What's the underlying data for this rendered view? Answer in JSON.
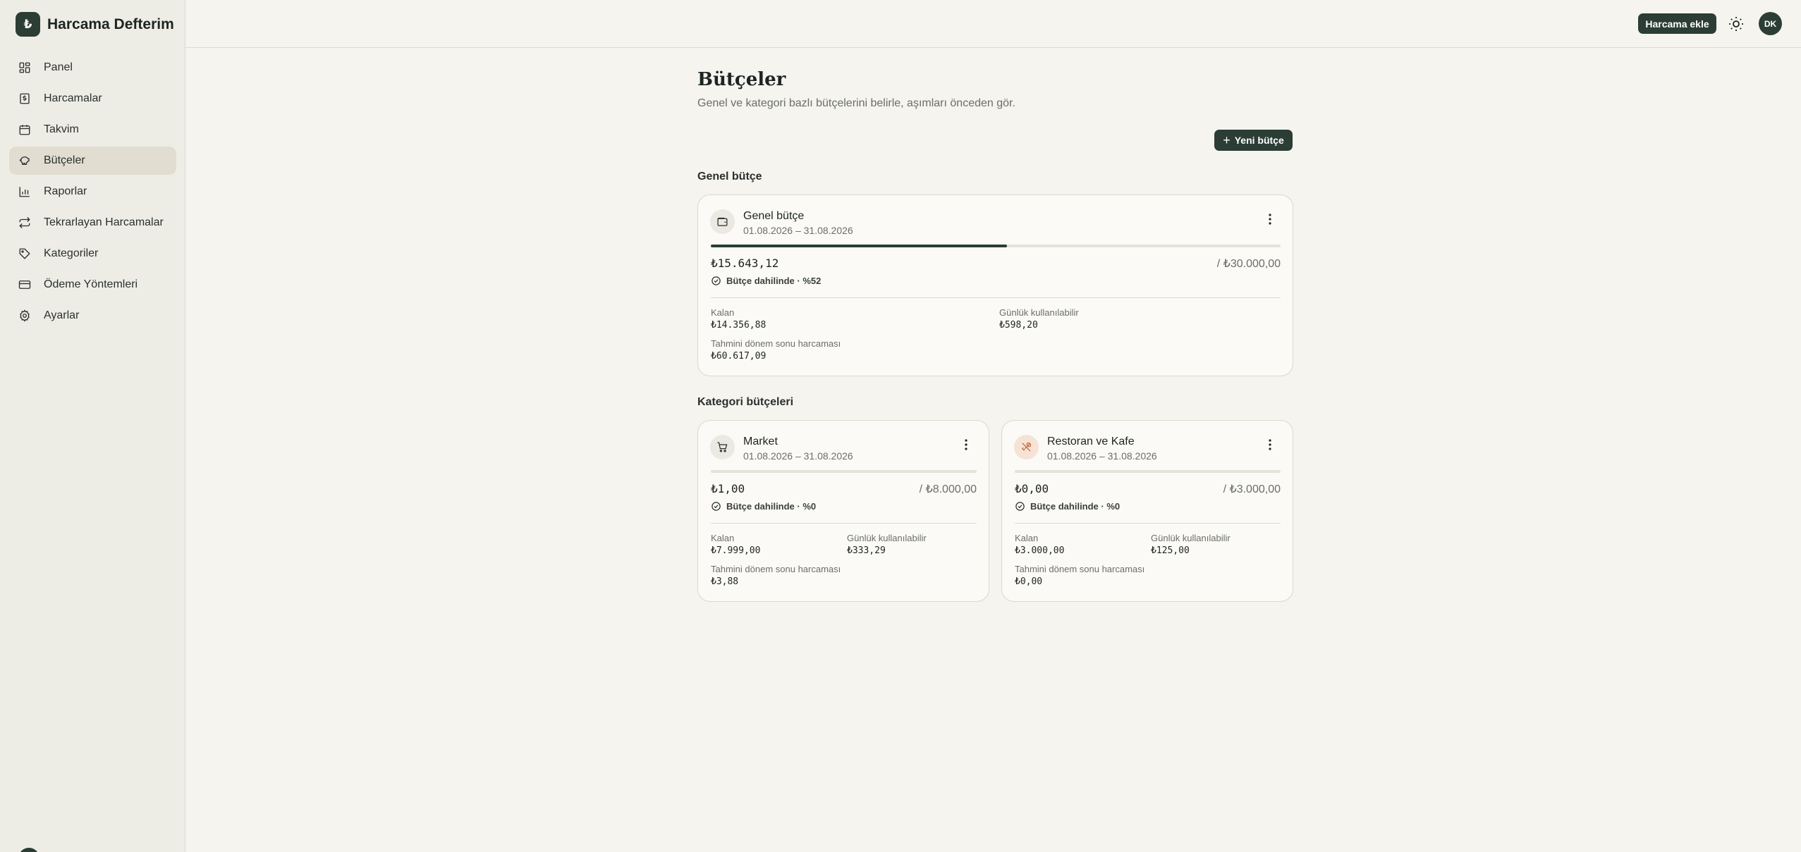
{
  "app": {
    "logo_glyph": "₺",
    "name": "Harcama Defterim"
  },
  "sidebar": {
    "items": [
      {
        "label": "Panel",
        "icon": "dashboard-icon"
      },
      {
        "label": "Harcamalar",
        "icon": "receipt-icon"
      },
      {
        "label": "Takvim",
        "icon": "calendar-icon"
      },
      {
        "label": "Bütçeler",
        "icon": "piggy-bank-icon",
        "active": true
      },
      {
        "label": "Raporlar",
        "icon": "bar-chart-icon"
      },
      {
        "label": "Tekrarlayan Harcamalar",
        "icon": "repeat-icon"
      },
      {
        "label": "Kategoriler",
        "icon": "tag-icon"
      },
      {
        "label": "Ödeme Yöntemleri",
        "icon": "credit-card-icon"
      },
      {
        "label": "Ayarlar",
        "icon": "gear-icon"
      }
    ]
  },
  "topbar": {
    "add_expense_label": "Harcama ekle",
    "theme_icon": "sun-icon",
    "avatar_initials": "DK"
  },
  "page": {
    "title": "Bütçeler",
    "subtitle": "Genel ve kategori bazlı bütçelerini belirle, aşımları önceden gör.",
    "new_budget_label": "Yeni bütçe",
    "general_section_title": "Genel bütçe",
    "category_section_title": "Kategori bütçeleri"
  },
  "colors": {
    "accent": "#2b3d35",
    "background": "#f5f4ef",
    "sidebar": "#eeede5",
    "card": "#fbfaf6"
  },
  "general_budget": {
    "name": "Genel bütçe",
    "icon": "wallet-icon",
    "date_range": "01.08.2026 – 31.08.2026",
    "spent": "₺15.643,12",
    "limit": "/ ₺30.000,00",
    "progress_fraction": 0.52,
    "status": "Bütçe dahilinde · %52",
    "remaining_label": "Kalan",
    "remaining_value": "₺14.356,88",
    "daily_label": "Günlük kullanılabilir",
    "daily_value": "₺598,20",
    "forecast_label": "Tahmini dönem sonu harcaması",
    "forecast_value": "₺60.617,09"
  },
  "category_budgets": [
    {
      "name": "Market",
      "icon": "shopping-cart-icon",
      "date_range": "01.08.2026 – 31.08.2026",
      "spent": "₺1,00",
      "limit": "/ ₺8.000,00",
      "progress_fraction": 0.0,
      "status": "Bütçe dahilinde · %0",
      "remaining_label": "Kalan",
      "remaining_value": "₺7.999,00",
      "daily_label": "Günlük kullanılabilir",
      "daily_value": "₺333,29",
      "forecast_label": "Tahmini dönem sonu harcaması",
      "forecast_value": "₺3,88"
    },
    {
      "name": "Restoran ve Kafe",
      "icon": "utensils-icon",
      "date_range": "01.08.2026 – 31.08.2026",
      "spent": "₺0,00",
      "limit": "/ ₺3.000,00",
      "progress_fraction": 0.0,
      "status": "Bütçe dahilinde · %0",
      "remaining_label": "Kalan",
      "remaining_value": "₺3.000,00",
      "daily_label": "Günlük kullanılabilir",
      "daily_value": "₺125,00",
      "forecast_label": "Tahmini dönem sonu harcaması",
      "forecast_value": "₺0,00"
    }
  ]
}
